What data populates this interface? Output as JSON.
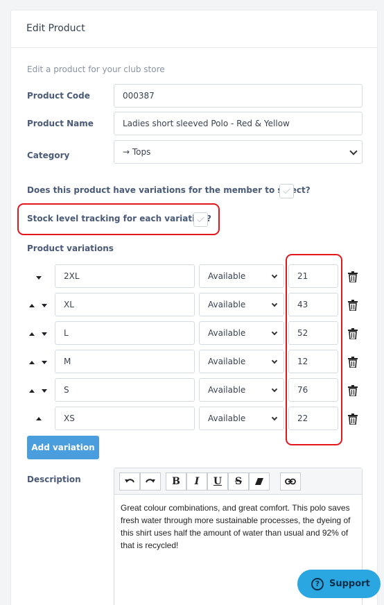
{
  "page": {
    "title": "Edit Product",
    "subtitle": "Edit a product for your club store"
  },
  "form": {
    "product_code_label": "Product Code",
    "product_code_value": "000387",
    "product_name_label": "Product Name",
    "product_name_value": "Ladies short sleeved Polo - Red & Yellow",
    "category_label": "Category",
    "category_value": "→ Tops",
    "variations_question": "Does this product have variations for the member to select?",
    "stock_tracking_question": "Stock level tracking for each variation?",
    "variations_heading": "Product variations",
    "add_variation_label": "Add variation",
    "description_label": "Description"
  },
  "variations": [
    {
      "name": "2XL",
      "status": "Available",
      "stock": "21"
    },
    {
      "name": "XL",
      "status": "Available",
      "stock": "43"
    },
    {
      "name": "L",
      "status": "Available",
      "stock": "52"
    },
    {
      "name": "M",
      "status": "Available",
      "stock": "12"
    },
    {
      "name": "S",
      "status": "Available",
      "stock": "76"
    },
    {
      "name": "XS",
      "status": "Available",
      "stock": "22"
    }
  ],
  "editor": {
    "toolbar": {
      "bold": "B",
      "italic": "I",
      "underline": "U",
      "strike": "S"
    },
    "content": "Great colour combinations, and great comfort. This polo saves fresh water through more sustainable processes, the dyeing of this shirt uses half the amount of water than usual and 92% of that is recycled!"
  },
  "support": {
    "label": "Support",
    "icon_glyph": "?"
  },
  "colors": {
    "accent": "#4a9ede",
    "highlight": "#e3161b",
    "support_bg": "#2aa7e0"
  }
}
